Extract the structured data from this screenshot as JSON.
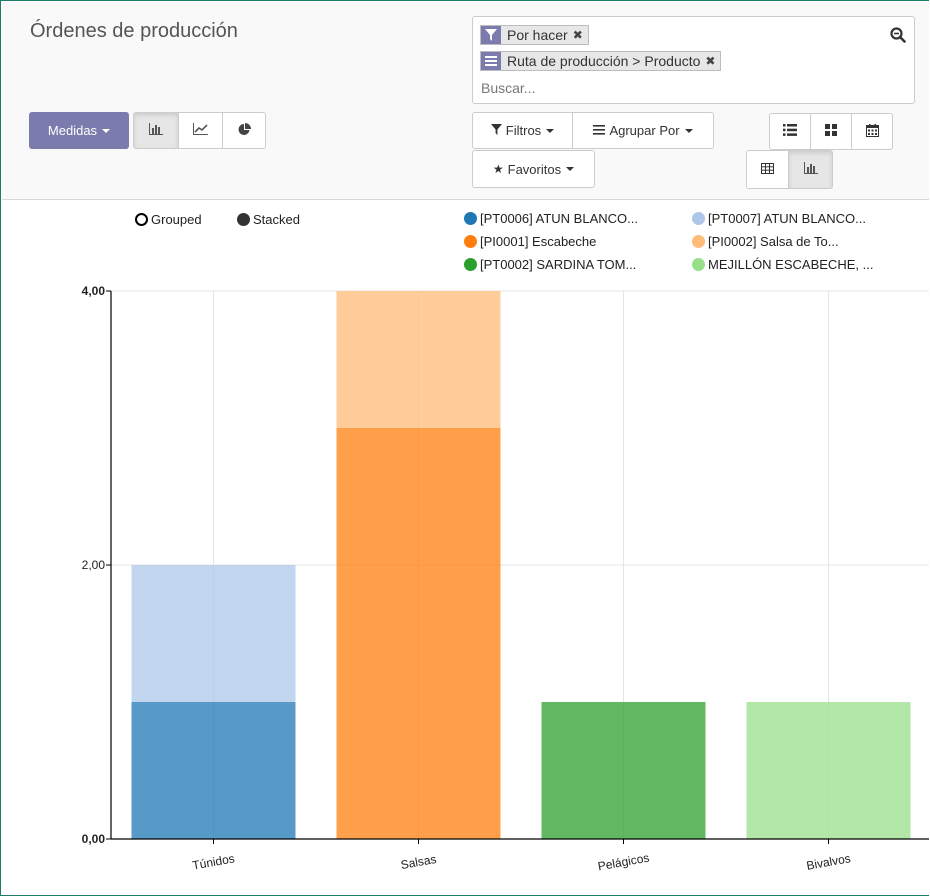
{
  "page": {
    "title": "Órdenes de producción"
  },
  "search": {
    "facets": [
      {
        "icon": "filter-icon",
        "label": "Por hacer"
      },
      {
        "icon": "groupby-icon",
        "label": "Ruta de producción > Producto"
      }
    ],
    "placeholder": "Buscar..."
  },
  "toolbar": {
    "measures_label": "Medidas",
    "filters_label": "Filtros",
    "groupby_label": "Agrupar Por",
    "favorites_label": "Favoritos",
    "chart_modes": [
      "bar-chart-icon",
      "line-chart-icon",
      "pie-chart-icon"
    ],
    "active_chart_mode": "bar-chart-icon",
    "views": [
      "list-view-icon",
      "kanban-view-icon",
      "calendar-view-icon",
      "pivot-view-icon",
      "graph-view-icon"
    ],
    "active_view": "graph-view-icon",
    "accent_color": "#7c7bad"
  },
  "chart_options": {
    "grouped_label": "Grouped",
    "stacked_label": "Stacked",
    "selected": "Stacked"
  },
  "chart_data": {
    "type": "bar",
    "stacked": true,
    "categories": [
      "Túnidos",
      "Salsas",
      "Pelágicos",
      "Bivalvos"
    ],
    "ylim": [
      0,
      4
    ],
    "yticks": [
      "0,00",
      "2,00",
      "4,00"
    ],
    "grid": true,
    "legend_position": "top-right",
    "series": [
      {
        "name": "[PT0006] ATUN BLANCO...",
        "color": "#1f77b4",
        "values": [
          1,
          0,
          0,
          0
        ]
      },
      {
        "name": "[PT0007] ATUN BLANCO...",
        "color": "#aec7e8",
        "values": [
          1,
          0,
          0,
          0
        ]
      },
      {
        "name": "[PI0001] Escabeche",
        "color": "#ff7f0e",
        "values": [
          0,
          3,
          0,
          0
        ]
      },
      {
        "name": "[PI0002] Salsa de To...",
        "color": "#ffbb78",
        "values": [
          0,
          1,
          0,
          0
        ]
      },
      {
        "name": "[PT0002] SARDINA TOM...",
        "color": "#2ca02c",
        "values": [
          0,
          0,
          1,
          0
        ]
      },
      {
        "name": "MEJILLÓN ESCABECHE, ...",
        "color": "#98df8a",
        "values": [
          0,
          0,
          0,
          1
        ]
      }
    ]
  }
}
